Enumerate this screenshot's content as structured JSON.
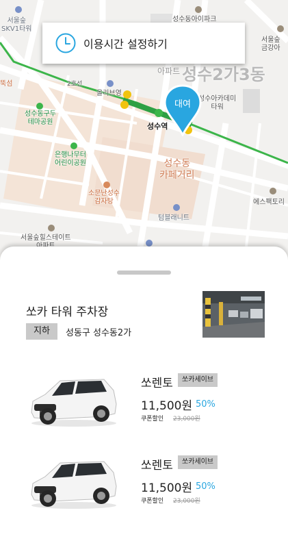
{
  "map": {
    "labels": {
      "skv1_tower": "서울숲\nSKV1타워",
      "seongsu_apt_park": "성수동아이파크",
      "gangyu": "서울숲\n금강아",
      "line2": "2호선",
      "ttuksom": "뚝섬",
      "seongsu_2ga_3dong": "성수2가3동",
      "apt": "아파트",
      "olive_young": "올리브영",
      "academy_tower": "성수아카데미\n타워",
      "seongsudong_park": "성수동구두\n테마공원",
      "seongsu_station": "성수역",
      "ginkgo_park": "은행나무터\n어린이공원",
      "cafe_street": "성수동\n카페거리",
      "sopungnan": "소문난성수\n감자탕",
      "sfactory": "에스팩토리",
      "tumbling": "텀블래니트",
      "hills_estate": "서울숲힐스테이트\n아파트"
    },
    "pin_label": "대여"
  },
  "time_setting": {
    "label": "이용시간 설정하기",
    "icon": "clock-icon"
  },
  "lot": {
    "name": "쏘카 타워 주차장",
    "floor": "지하",
    "address": "성동구 성수동2가"
  },
  "cars": [
    {
      "name": "쏘렌토",
      "badge": "쏘카세이브",
      "price": "11,500원",
      "discount": "50%",
      "coupon_label": "쿠폰할인",
      "original_price": "23,000원"
    },
    {
      "name": "쏘렌토",
      "badge": "쏘카세이브",
      "price": "11,500원",
      "discount": "50%",
      "coupon_label": "쿠폰할인",
      "original_price": "23,000원"
    }
  ],
  "colors": {
    "accent": "#29a6e0",
    "subway": "#3cb54a",
    "sheet": "#ffffff"
  }
}
